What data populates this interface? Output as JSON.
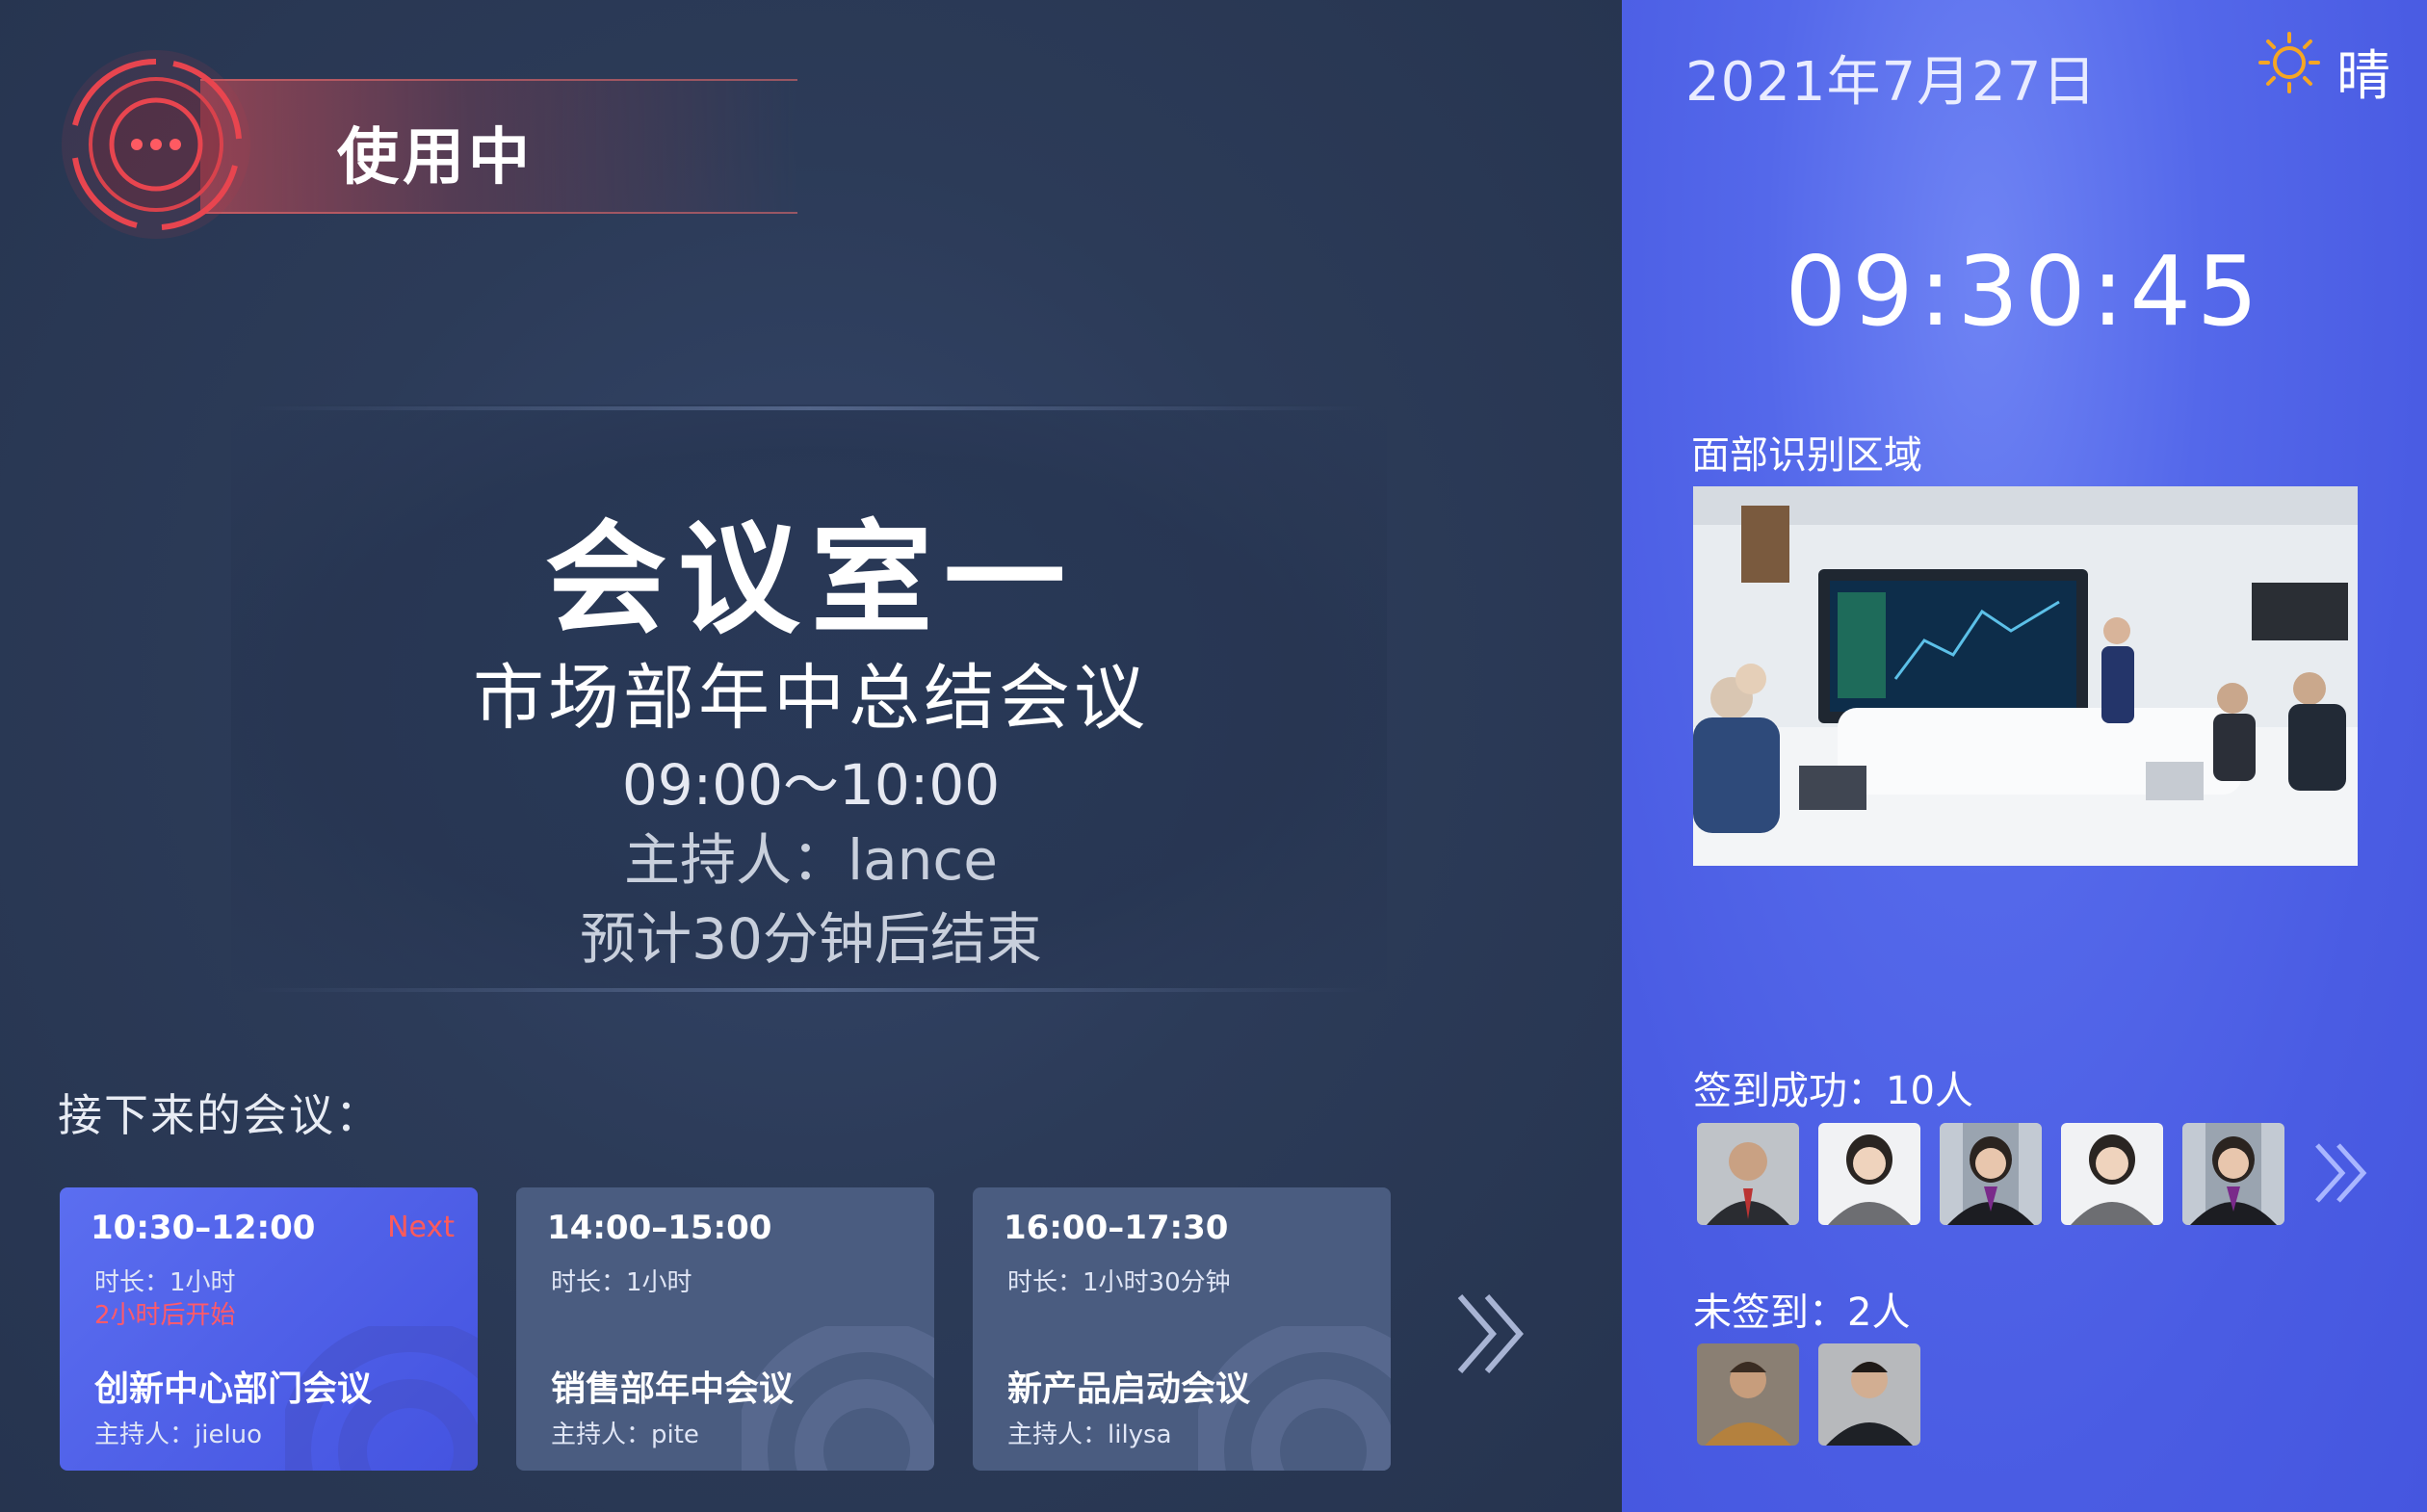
{
  "status": {
    "label": "使用中"
  },
  "room": {
    "name": "会议室一",
    "meeting_title": "市场部年中总结会议",
    "time": "09:00～10:00",
    "host": "主持人：lance",
    "end_hint": "预计30分钟后结束"
  },
  "upcoming": {
    "label": "接下来的会议：",
    "cards": [
      {
        "time": "10:30–12:00",
        "badge": "Next",
        "duration": "时长：1小时",
        "starts": "2小时后开始",
        "name": "创新中心部门会议",
        "host": "主持人：jieluo"
      },
      {
        "time": "14:00–15:00",
        "duration": "时长：1小时",
        "name": "销售部年中会议",
        "host": "主持人：pite"
      },
      {
        "time": "16:00–17:30",
        "duration": "时长：1小时30分钟",
        "name": "新产品启动会议",
        "host": "主持人：lilysa"
      }
    ]
  },
  "sidebar": {
    "date": "2021年7月27日",
    "weather": "晴",
    "clock": "09:30:45",
    "face_label": "面部识别区域",
    "checked_in": "签到成功：10人",
    "not_checked_in": "未签到：2人"
  },
  "icons": {
    "status": "alert-ring-icon",
    "weather": "sun-icon",
    "more_meetings": "double-chevron-right-icon",
    "more_attendees": "double-chevron-right-icon"
  },
  "colors": {
    "left_bg": "#2b3a55",
    "right_bg": "#4a5ce3",
    "status_red": "#e04e56",
    "active_card": "#5066ee",
    "card": "#4a5c80",
    "next_badge": "#ff5a5a",
    "sun": "#f5a623"
  }
}
